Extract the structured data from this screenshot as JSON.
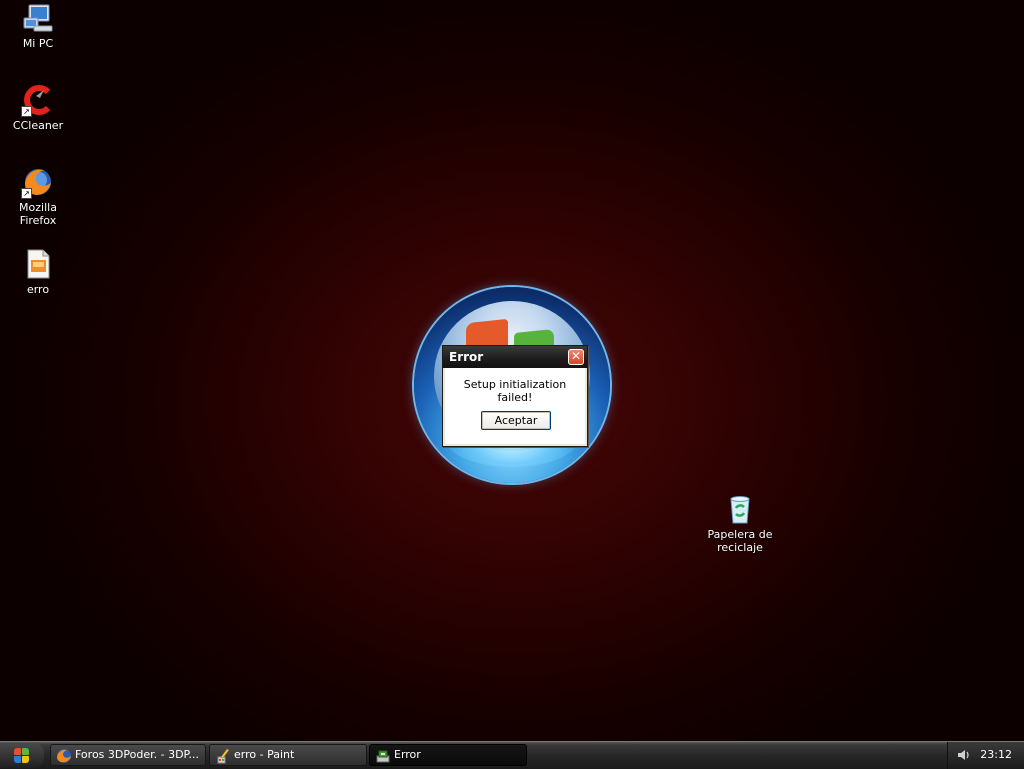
{
  "desktop": {
    "icons": [
      {
        "label": "Mi PC"
      },
      {
        "label": "CCleaner"
      },
      {
        "label": "Mozilla Firefox"
      },
      {
        "label": "erro"
      },
      {
        "label": "Papelera de reciclaje"
      }
    ]
  },
  "dialog": {
    "title": "Error",
    "message": "Setup initialization failed!",
    "ok_label": "Aceptar",
    "close_glyph": "✕"
  },
  "taskbar": {
    "tasks": [
      {
        "label": "Foros 3DPoder. - 3DP...",
        "icon": "firefox-icon"
      },
      {
        "label": "erro - Paint",
        "icon": "paint-icon"
      },
      {
        "label": "Error",
        "icon": "setup-icon"
      }
    ],
    "clock": "23:12"
  },
  "colors": {
    "desktop_bg": "#2c0202",
    "close_button": "#d8452a",
    "taskbar": "#262626"
  }
}
